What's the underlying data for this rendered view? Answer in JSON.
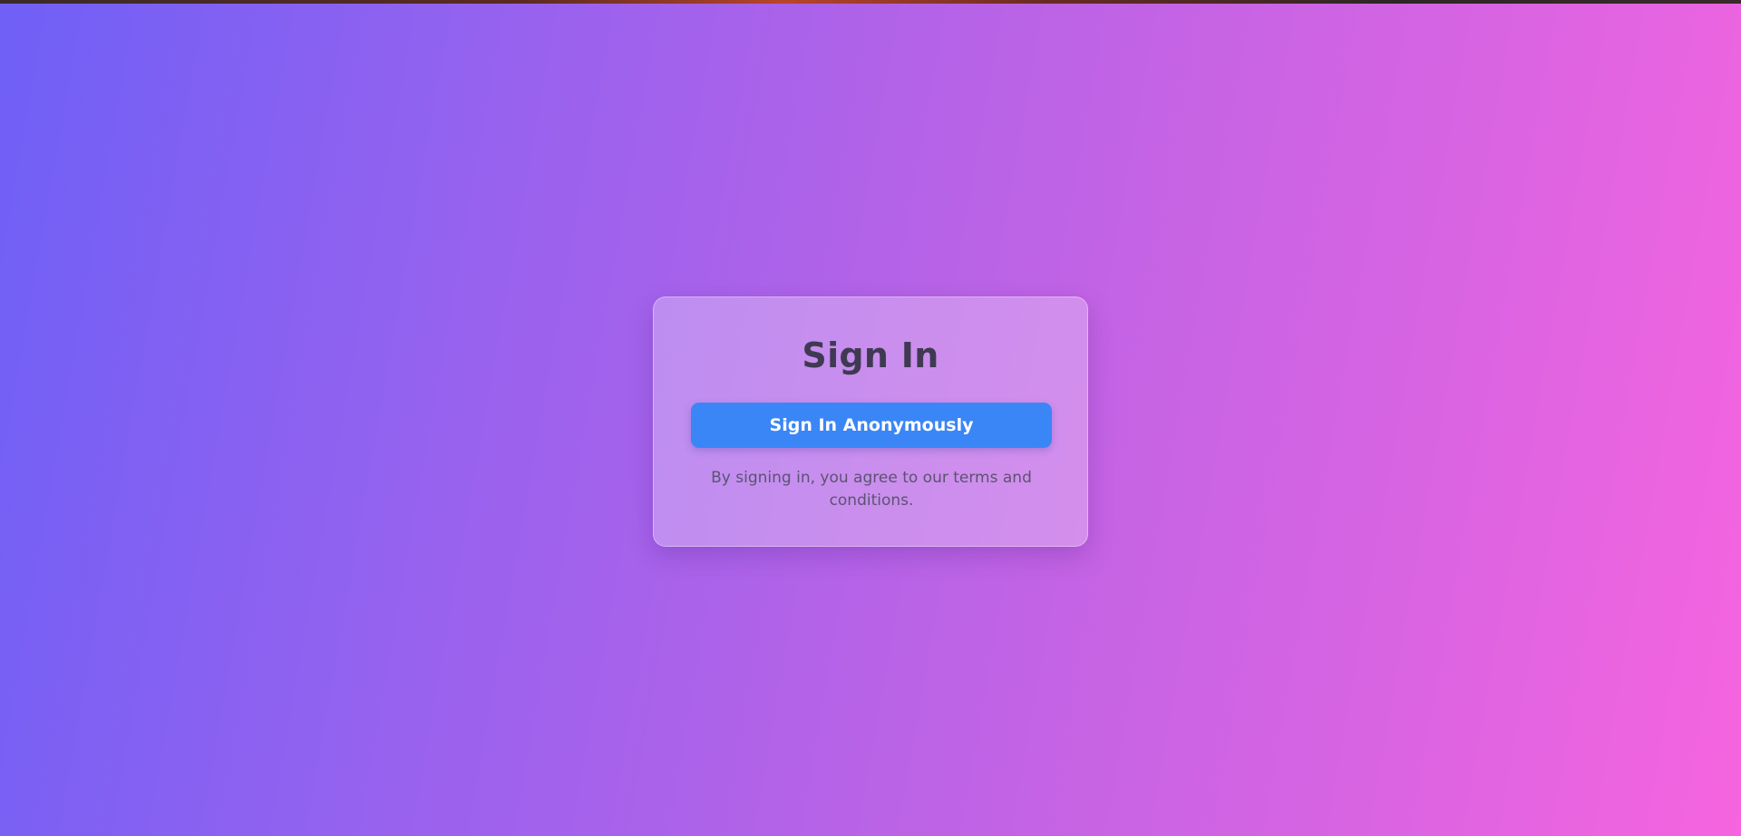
{
  "signin": {
    "title": "Sign In",
    "anonymous_button_label": "Sign In Anonymously",
    "terms_text": "By signing in, you agree to our terms and conditions."
  },
  "colors": {
    "gradient_start": "#6f60f6",
    "gradient_end": "#f664df",
    "button_bg": "#3b86f6",
    "title_text": "#3f3a52"
  }
}
